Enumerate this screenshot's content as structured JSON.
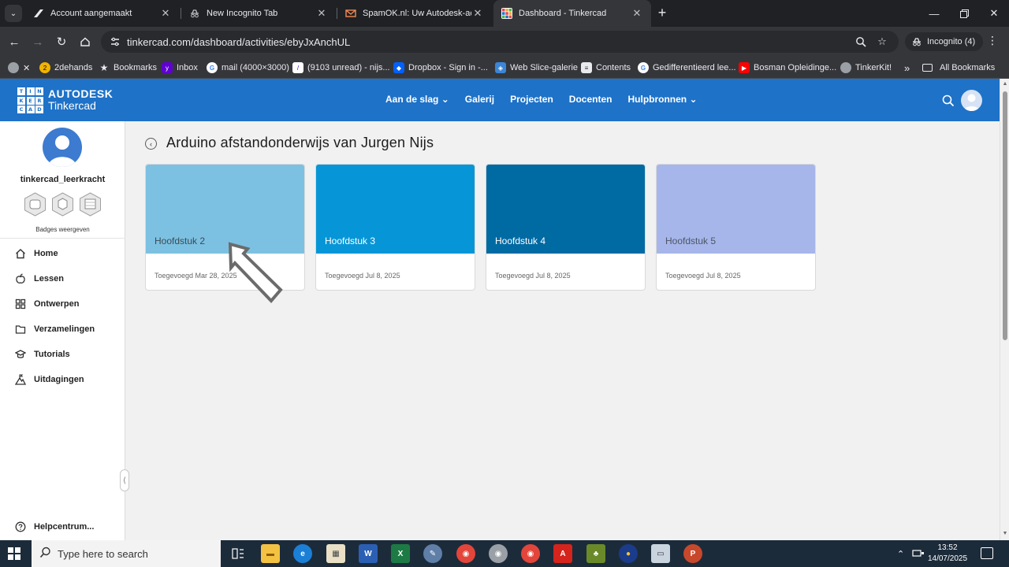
{
  "browser": {
    "tabs": [
      {
        "title": "Account aangemaakt",
        "close": "✕"
      },
      {
        "title": "New Incognito Tab",
        "close": "✕"
      },
      {
        "title": "SpamOK.nl: Uw Autodesk-acco",
        "close": "✕"
      },
      {
        "title": "Dashboard - Tinkercad",
        "close": "✕"
      }
    ],
    "new_tab": "+",
    "url": "tinkercad.com/dashboard/activities/ebyJxAnchUL",
    "incognito_label": "Incognito (4)",
    "bookmarks": [
      {
        "label": "2dehands"
      },
      {
        "label": "Bookmarks"
      },
      {
        "label": "Inbox"
      },
      {
        "label": "mail (4000×3000)"
      },
      {
        "label": "(9103 unread) - nijs..."
      },
      {
        "label": "Dropbox - Sign in -..."
      },
      {
        "label": "Web Slice-galerie"
      },
      {
        "label": "Contents"
      },
      {
        "label": "Gedifferentieerd lee..."
      },
      {
        "label": "Bosman Opleidinge..."
      },
      {
        "label": "TinkerKit!"
      }
    ],
    "bookmarks_overflow": "»",
    "all_bookmarks": "All Bookmarks"
  },
  "tinkercad": {
    "logo_letters": [
      "TIN",
      "KER",
      "CAD"
    ],
    "brand_top": "AUTODESK",
    "brand_bottom": "Tinkercad",
    "nav": [
      {
        "label": "Aan de slag ⌄"
      },
      {
        "label": "Galerij"
      },
      {
        "label": "Projecten"
      },
      {
        "label": "Docenten"
      },
      {
        "label": "Hulpbronnen ⌄"
      }
    ],
    "sidebar": {
      "username": "tinkercad_leerkracht",
      "badges_label": "Badges weergeven",
      "items": [
        {
          "label": "Home"
        },
        {
          "label": "Lessen"
        },
        {
          "label": "Ontwerpen"
        },
        {
          "label": "Verzamelingen"
        },
        {
          "label": "Tutorials"
        },
        {
          "label": "Uitdagingen"
        }
      ],
      "help": "Helpcentrum..."
    },
    "page_title": "Arduino afstandonderwijs van Jurgen Nijs",
    "cards": [
      {
        "name": "Hoofdstuk 2",
        "date": "Toegevoegd Mar 28, 2025",
        "color": "#7cc1e2",
        "text_color": "#3e4a52"
      },
      {
        "name": "Hoofdstuk 3",
        "date": "Toegevoegd Jul 8, 2025",
        "color": "#0696d7",
        "text_color": "#ffffff"
      },
      {
        "name": "Hoofdstuk 4",
        "date": "Toegevoegd Jul 8, 2025",
        "color": "#006aa3",
        "text_color": "#ffffff"
      },
      {
        "name": "Hoofdstuk 5",
        "date": "Toegevoegd Jul 8, 2025",
        "color": "#a6b6ea",
        "text_color": "#4d5566"
      }
    ]
  },
  "taskbar": {
    "search_placeholder": "Type here to search",
    "time": "13:52",
    "date": "14/07/2025"
  },
  "colors": {
    "header_blue": "#1e72c8",
    "page_bg": "#f1f1f1"
  }
}
